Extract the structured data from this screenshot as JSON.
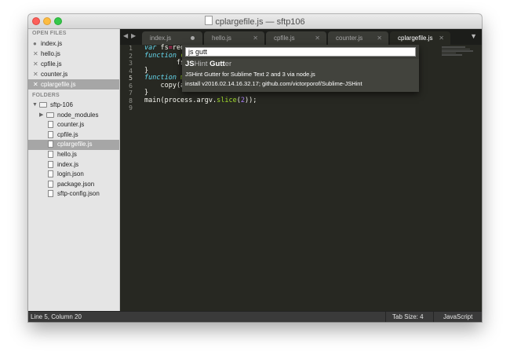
{
  "window": {
    "title": "cplargefile.js — sftp106",
    "traffic_lights": {
      "close": "#fc605b",
      "minimize": "#fdbc40",
      "zoom": "#34c84a"
    }
  },
  "sidebar": {
    "open_files_heading": "OPEN FILES",
    "open_files": [
      {
        "name": "index.js",
        "state": "modified"
      },
      {
        "name": "hello.js",
        "state": "close"
      },
      {
        "name": "cpfile.js",
        "state": "close"
      },
      {
        "name": "counter.js",
        "state": "close"
      },
      {
        "name": "cplargefile.js",
        "state": "close",
        "selected": true
      }
    ],
    "folders_heading": "FOLDERS",
    "root_folder": "sftp-106",
    "subfolder": "node_modules",
    "files": [
      "counter.js",
      "cpfile.js",
      "cplargefile.js",
      "hello.js",
      "index.js",
      "login.json",
      "package.json",
      "sftp-config.json"
    ],
    "selected_file": "cplargefile.js"
  },
  "tabs": [
    {
      "label": "index.js",
      "state": "modified"
    },
    {
      "label": "hello.js",
      "state": "close"
    },
    {
      "label": "cpfile.js",
      "state": "close"
    },
    {
      "label": "counter.js",
      "state": "close"
    },
    {
      "label": "cplargefile.js",
      "state": "active"
    }
  ],
  "editor": {
    "line_numbers": [
      "1",
      "2",
      "3",
      "4",
      "5",
      "6",
      "7",
      "8",
      "9"
    ],
    "current_line": "5"
  },
  "command_palette": {
    "input_value": "js gutt",
    "result": {
      "title_match1": "JS",
      "title_rest1": "Hint ",
      "title_match2": "Gutt",
      "title_rest2": "er",
      "description": "JSHint Gutter for Sublime Text 2 and 3 via node.js",
      "install_info": "install v2016.02.14.16.32.17; github.com/victorporof/Sublime-JSHint"
    }
  },
  "status_bar": {
    "position": "Line 5, Column 20",
    "tab_size": "Tab Size: 4",
    "syntax": "JavaScript"
  },
  "theme": {
    "editor_bg": "#272822",
    "sidebar_bg": "#e5e5e5",
    "keyword": "#66d9ef",
    "operator": "#f92672",
    "function": "#a6e22e",
    "number": "#ae81ff"
  }
}
